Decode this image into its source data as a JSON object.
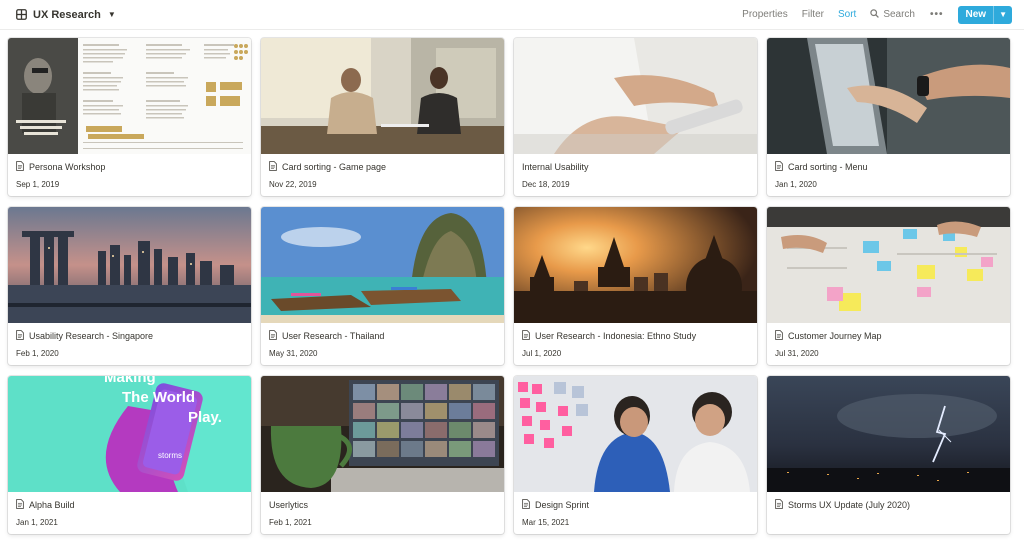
{
  "view": {
    "title": "UX Research",
    "icon": "table-icon"
  },
  "toolbar": {
    "properties": "Properties",
    "filter": "Filter",
    "sort": "Sort",
    "search": "Search",
    "more": "•••",
    "new": "New",
    "accent": "#2eaadc"
  },
  "cards": [
    {
      "title": "Persona Workshop",
      "date": "Sep 1, 2019",
      "cover": "persona-document"
    },
    {
      "title": "Card sorting - Game page",
      "date": "Nov 22, 2019",
      "cover": "two-people-meeting"
    },
    {
      "title": "Internal Usability",
      "date": "Dec 18, 2019",
      "cover": "hand-holding-phone"
    },
    {
      "title": "Card sorting - Menu",
      "date": "Jan 1, 2020",
      "cover": "hands-pointing-laptop"
    },
    {
      "title": "Usability Research - Singapore",
      "date": "Feb 1, 2020",
      "cover": "singapore-skyline"
    },
    {
      "title": "User Research - Thailand",
      "date": "May 31, 2020",
      "cover": "thailand-boats"
    },
    {
      "title": "User Research - Indonesia: Ethno Study",
      "date": "Jul 1, 2020",
      "cover": "temple-sunset"
    },
    {
      "title": "Customer Journey Map",
      "date": "Jul 31, 2020",
      "cover": "sticky-notes-table"
    },
    {
      "title": "Alpha Build",
      "date": "Jan 1, 2021",
      "cover": "app-promo",
      "cover_text": [
        "Making",
        "The World",
        "Play."
      ],
      "cover_brand": "storms"
    },
    {
      "title": "Userlytics",
      "date": "Feb 1, 2021",
      "cover": "video-call-laptop"
    },
    {
      "title": "Design Sprint",
      "date": "Mar 15, 2021",
      "cover": "whiteboard-sprint"
    },
    {
      "title": "Storms UX Update (July 2020)",
      "date": "",
      "cover": "lightning-storm"
    }
  ]
}
